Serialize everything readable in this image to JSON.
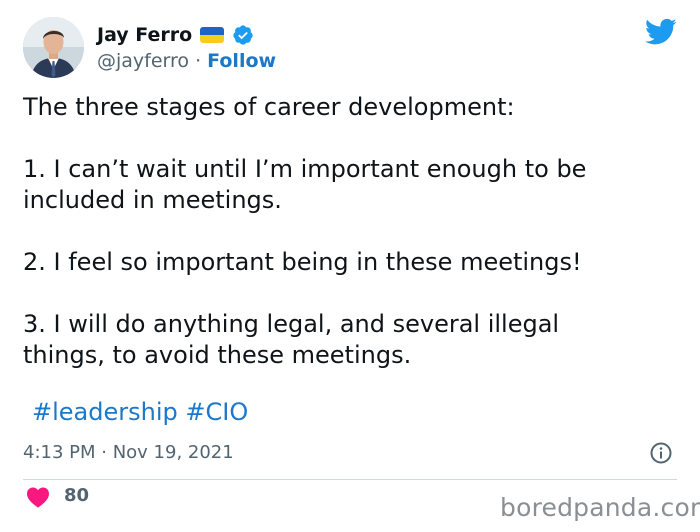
{
  "author": {
    "display_name": "Jay Ferro",
    "handle": "@jayferro",
    "separator": " · ",
    "follow_label": "Follow",
    "flag_icon": "ukraine-flag-icon",
    "verified_icon": "verified-badge-icon"
  },
  "tweet": {
    "paragraphs": [
      [
        "The three stages of career development:"
      ],
      [
        "1. I can’t wait until I’m important enough to be",
        "included in meetings."
      ],
      [
        "2. I feel so important being in these meetings!"
      ],
      [
        "3. I will do anything legal, and several illegal",
        "things, to avoid these meetings."
      ]
    ],
    "hashtags": [
      "#leadership",
      "#CIO"
    ],
    "timestamp": "4:13 PM · Nov 19, 2021"
  },
  "engagement": {
    "like_count": "80",
    "like_icon": "heart-icon"
  },
  "watermark": "boredpanda.com",
  "colors": {
    "link": "#1d78c9",
    "secondary_text": "#536471",
    "heart": "#f91880",
    "twitter_blue": "#1d9bf0",
    "divider": "#cfd9de"
  }
}
